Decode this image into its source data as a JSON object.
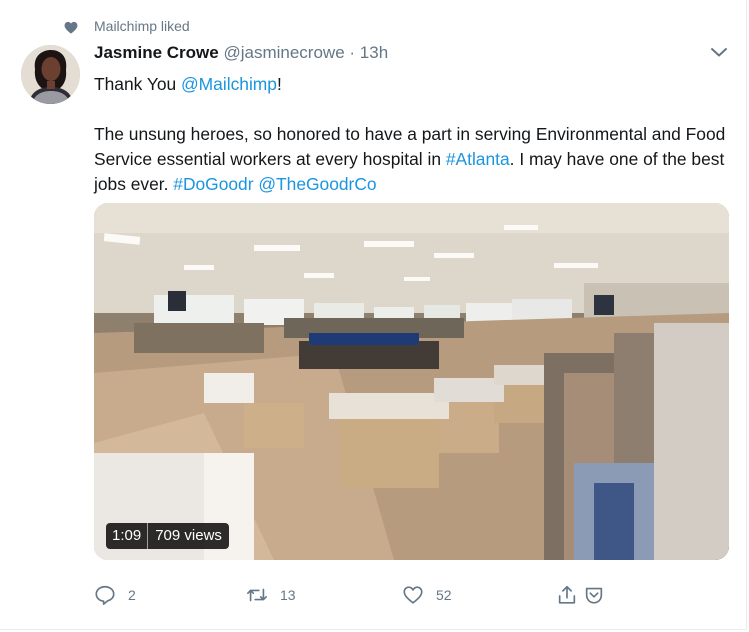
{
  "social_context": {
    "label": "Mailchimp liked",
    "icon": "heart-icon"
  },
  "author": {
    "name": "Jasmine Crowe",
    "handle": "@jasminecrowe",
    "separator": "·",
    "time": "13h"
  },
  "tweet": {
    "line1_prefix": "Thank You ",
    "line1_mention": "@Mailchimp",
    "line1_suffix": "!",
    "body_part1": "The unsung heroes, so honored to have a part in serving Environmental and Food Service essential workers at every hospital in ",
    "body_hashtag_atlanta": "#Atlanta",
    "body_part2": ". I may have one of the best jobs ever. ",
    "body_hashtag_dogoodr": "#DoGoodr",
    "body_space": " ",
    "body_mention_goodrco": "@TheGoodrCo"
  },
  "video": {
    "duration": "1:09",
    "views": "709 views"
  },
  "actions": {
    "replies": "2",
    "retweets": "13",
    "likes": "52"
  },
  "colors": {
    "link": "#1b95e0",
    "muted": "#657786",
    "text": "#14171a"
  }
}
